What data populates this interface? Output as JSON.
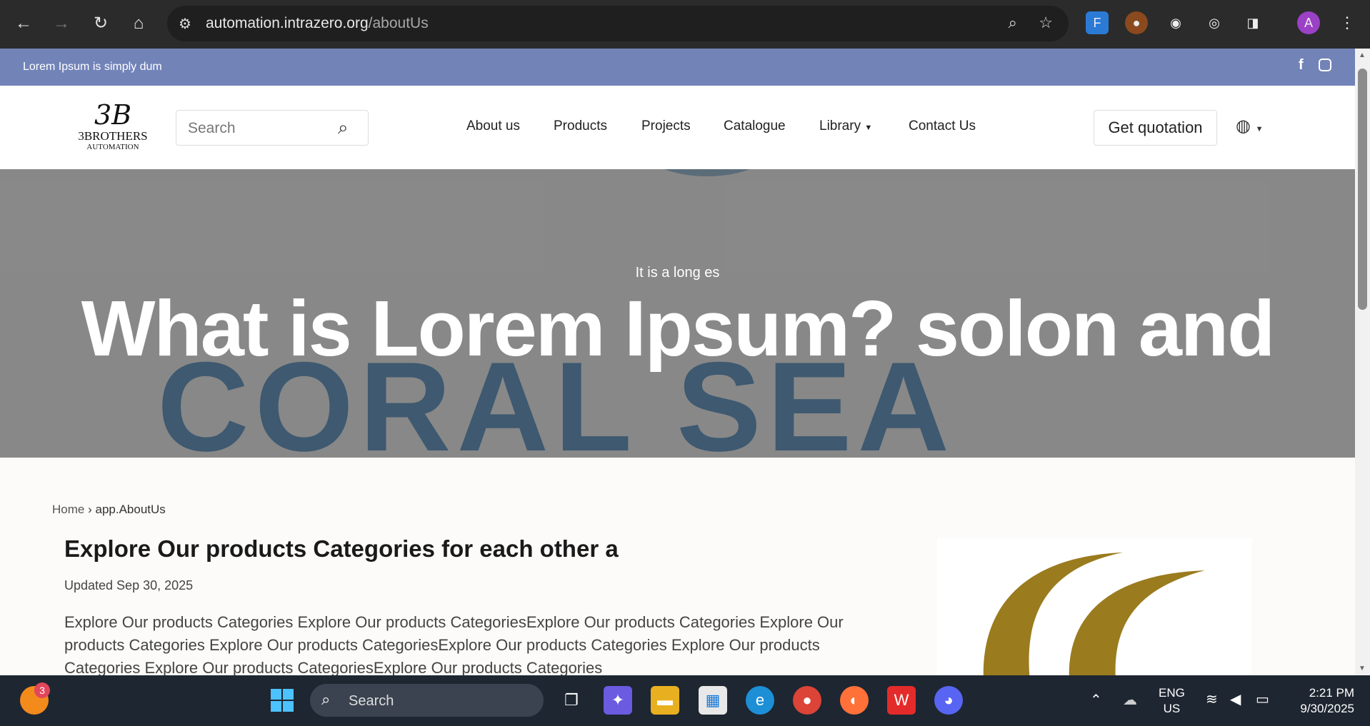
{
  "browser": {
    "url_domain": "automation.intrazero.org",
    "url_path": "/aboutUs",
    "profile_initial": "A",
    "icons": [
      "back-icon",
      "forward-icon",
      "reload-icon",
      "home-icon",
      "site-settings-icon",
      "zoom-icon",
      "bookmark-star-icon",
      "extensions-icon",
      "menu-icon"
    ]
  },
  "topbar": {
    "text": "Lorem Ipsum is simply dum",
    "icons": [
      "facebook-icon",
      "instagram-icon"
    ]
  },
  "header": {
    "logo": {
      "mark": "3B",
      "name": "3BROTHERS",
      "sub": "AUTOMATION"
    },
    "search_placeholder": "Search",
    "nav": [
      "About us",
      "Products",
      "Projects",
      "Catalogue",
      "Library",
      "Contact Us"
    ],
    "quote_button": "Get quotation"
  },
  "hero": {
    "background_text": "CORAL SEA",
    "subtitle": "It is a long es",
    "title": "What is Lorem Ipsum? solon and"
  },
  "content": {
    "breadcrumb_home": "Home",
    "breadcrumb_sep": "›",
    "breadcrumb_current": "app.AboutUs",
    "title": "Explore Our products Categories for each other a",
    "updated": "Updated Sep 30, 2025",
    "paragraph": "Explore Our products Categories Explore Our products CategoriesExplore Our products Categories Explore Our products Categories Explore Our products CategoriesExplore Our products Categories Explore Our products Categories Explore Our products CategoriesExplore Our products Categories"
  },
  "taskbar": {
    "search_label": "Search",
    "notification_count": "3",
    "language": "ENG",
    "region": "US",
    "time": "2:21 PM",
    "date": "9/30/2025"
  },
  "colors": {
    "topbar": "#7283b8",
    "browser_chrome": "#2b2b2b",
    "taskbar": "#1e2631",
    "logo_gold": "#9a7b1e"
  }
}
